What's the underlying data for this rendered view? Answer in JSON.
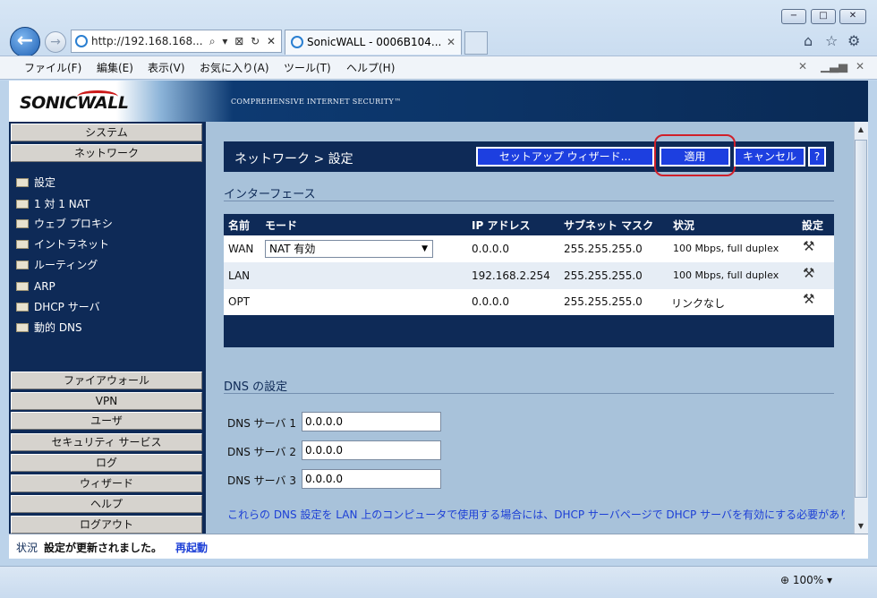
{
  "browser": {
    "address": "http://192.168.168...",
    "address_controls": "⌕ ▾ ⊠ ↻ ✕",
    "tab_title": "SonicWALL - 0006B104...",
    "tab_close": "✕",
    "menu": [
      "ファイル(F)",
      "編集(E)",
      "表示(V)",
      "お気に入り(A)",
      "ツール(T)",
      "ヘルプ(H)"
    ],
    "zoom": "100%",
    "window_buttons": [
      "−",
      "□",
      "✕"
    ]
  },
  "banner": {
    "logo": "SONICWALL",
    "tagline": "COMPREHENSIVE INTERNET SECURITY™"
  },
  "nav": {
    "top_buttons": [
      "システム",
      "ネットワーク"
    ],
    "items": [
      "設定",
      "1 対 1 NAT",
      "ウェブ プロキシ",
      "イントラネット",
      "ルーティング",
      "ARP",
      "DHCP サーバ",
      "動的 DNS"
    ],
    "bottom_buttons": [
      "ファイアウォール",
      "VPN",
      "ユーザ",
      "セキュリティ サービス",
      "ログ",
      "ウィザード",
      "ヘルプ",
      "ログアウト"
    ]
  },
  "main": {
    "title": "ネットワーク > 設定",
    "buttons": {
      "wizard": "セットアップ ウィザード...",
      "apply": "適用",
      "cancel": "キャンセル",
      "help": "?"
    },
    "interface_section": "インターフェース",
    "columns": [
      "名前",
      "モード",
      "IP アドレス",
      "サブネット マスク",
      "状況",
      "設定"
    ],
    "rows": [
      {
        "name": "WAN",
        "mode": "NAT 有効",
        "ip": "0.0.0.0",
        "mask": "255.255.255.0",
        "status": "100 Mbps, full duplex"
      },
      {
        "name": "LAN",
        "mode": "",
        "ip": "192.168.2.254",
        "mask": "255.255.255.0",
        "status": "100 Mbps, full duplex"
      },
      {
        "name": "OPT",
        "mode": "",
        "ip": "0.0.0.0",
        "mask": "255.255.255.0",
        "status": "リンクなし"
      }
    ],
    "dns_section": "DNS の設定",
    "dns": [
      {
        "label": "DNS サーバ 1",
        "value": "0.0.0.0"
      },
      {
        "label": "DNS サーバ 2",
        "value": "0.0.0.0"
      },
      {
        "label": "DNS サーバ 3",
        "value": "0.0.0.0"
      }
    ],
    "note": "これらの DNS 設定を LAN 上のコンピュータで使用する場合には、DHCP サーバページで DHCP サーバを有効にする必要がありま す。"
  },
  "status": {
    "label": "状況",
    "message": "設定が更新されました。",
    "link": "再起動"
  },
  "colors": {
    "navy": "#0e2a57",
    "button_blue": "#1d3fe0",
    "highlight_ring": "#d0202a",
    "panel": "#a8c2da"
  }
}
